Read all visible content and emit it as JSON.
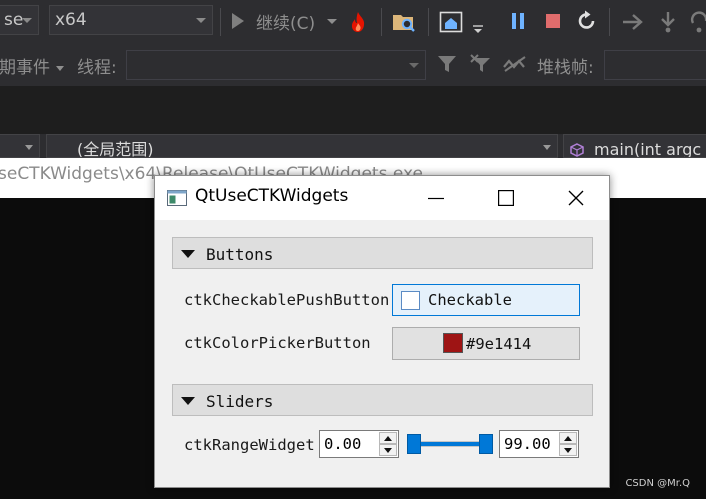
{
  "vs": {
    "toolbar1": {
      "config_combo": "se",
      "platform_combo": "x64",
      "continue_label": "继续(C)"
    },
    "toolbar2": {
      "lifecycle_label": "期事件",
      "thread_label": "线程:",
      "stackframe_label": "堆栈帧:"
    },
    "nav": {
      "scope_combo": "(全局范围)",
      "member_combo": "main(int argc"
    },
    "console_title": "seCTKWidgets\\x64\\Release\\QtUseCTKWidgets.exe"
  },
  "dialog": {
    "title": "QtUseCTKWidgets",
    "buttons_section": "Buttons",
    "checkable_label": "ctkCheckablePushButton",
    "checkable_text": "Checkable",
    "colorpicker_label": "ctkColorPickerButton",
    "color_text": "#9e1414",
    "color_value": "#9e1414",
    "sliders_section": "Sliders",
    "range_label": "ctkRangeWidget",
    "range_min": "0.00",
    "range_max": "99.00",
    "slider_min_fraction": 0.0,
    "slider_max_fraction": 1.0
  },
  "watermark": "CSDN @Mr.Q",
  "colors": {
    "vs_background": "#2d2d30",
    "accent_blue": "#0078d7",
    "debug_red": "#e51400",
    "console_bg": "#0c0c0c"
  }
}
